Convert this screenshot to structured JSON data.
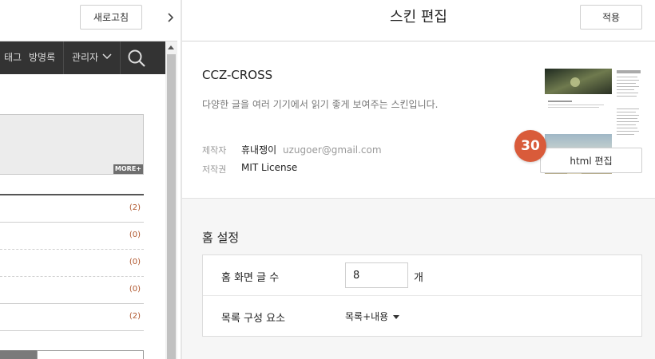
{
  "left": {
    "refresh_label": "새로고침",
    "nav": {
      "tag": "태그",
      "guestbook": "방명록",
      "admin": "관리자"
    },
    "more_label": "MORE+",
    "list_counts": [
      "(2)",
      "(0)",
      "(0)",
      "(0)",
      "(2)"
    ]
  },
  "right": {
    "title": "스킨 편집",
    "apply_label": "적용",
    "skin": {
      "name": "CCZ-CROSS",
      "description": "다양한 글을 여러 기기에서 읽기 좋게 보여주는 스킨입니다.",
      "maker_label": "제작자",
      "maker_name": "휴내쟁이",
      "maker_email": "uzugoer@gmail.com",
      "license_label": "저작권",
      "license_value": "MIT License",
      "html_edit_label": "html 편집",
      "badge": "30"
    },
    "home": {
      "title": "홈 설정",
      "post_count_label": "홈 화면 글 수",
      "post_count_value": "8",
      "post_count_unit": "개",
      "list_type_label": "목록 구성 요소",
      "list_type_value": "목록+내용"
    }
  },
  "colors": {
    "nav_bg": "#333333",
    "badge": "#d95b3a",
    "count_text": "#b0562c"
  }
}
